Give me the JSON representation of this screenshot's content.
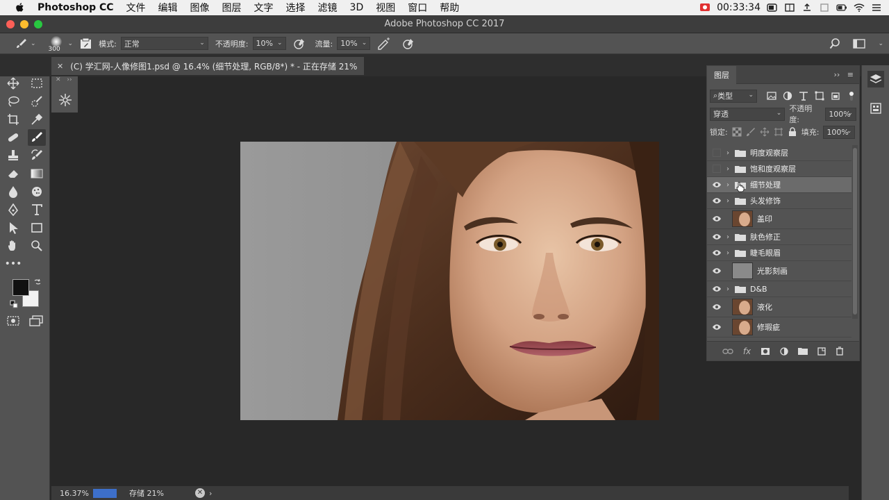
{
  "menubar": {
    "app_name": "Photoshop CC",
    "menus": [
      "文件",
      "编辑",
      "图像",
      "图层",
      "文字",
      "选择",
      "滤镜",
      "3D",
      "视图",
      "窗口",
      "帮助"
    ],
    "clock": "00:33:34"
  },
  "window": {
    "title": "Adobe Photoshop CC 2017"
  },
  "options": {
    "brush_size": "300",
    "mode_label": "模式:",
    "mode_value": "正常",
    "opacity_label": "不透明度:",
    "opacity_value": "10%",
    "flow_label": "流量:",
    "flow_value": "10%"
  },
  "document": {
    "tab_title": "(C) 学汇网-人像修图1.psd @ 16.4% (细节处理, RGB/8*) * - 正在存储 21%"
  },
  "status": {
    "zoom": "16.37%",
    "save_text": "存储 21%",
    "save_progress": 0.21
  },
  "layers_panel": {
    "tab": "图层",
    "filter_kind": "类型",
    "blend_mode": "穿透",
    "opacity_label": "不透明度:",
    "opacity_value": "100%",
    "lock_label": "锁定:",
    "fill_label": "填充:",
    "fill_value": "100%",
    "footer_fx": "fx",
    "layers": [
      {
        "name": "明度观察层",
        "type": "group",
        "visible": false
      },
      {
        "name": "饱和度观察层",
        "type": "group",
        "visible": false
      },
      {
        "name": "细节处理",
        "type": "group",
        "visible": true,
        "selected": true
      },
      {
        "name": "头发修饰",
        "type": "group",
        "visible": true
      },
      {
        "name": "盖印",
        "type": "pixel",
        "visible": true
      },
      {
        "name": "肤色修正",
        "type": "group",
        "visible": true
      },
      {
        "name": "睫毛眼眉",
        "type": "group",
        "visible": true
      },
      {
        "name": "光影刻画",
        "type": "pixel-gray",
        "visible": true
      },
      {
        "name": "D&B",
        "type": "group",
        "visible": true
      },
      {
        "name": "液化",
        "type": "pixel",
        "visible": true
      },
      {
        "name": "修瑕疵",
        "type": "pixel",
        "visible": true
      }
    ]
  },
  "colors": {
    "accent_progress": "#3d6fca",
    "foreground": "#111111",
    "background": "#f2f2f2"
  }
}
